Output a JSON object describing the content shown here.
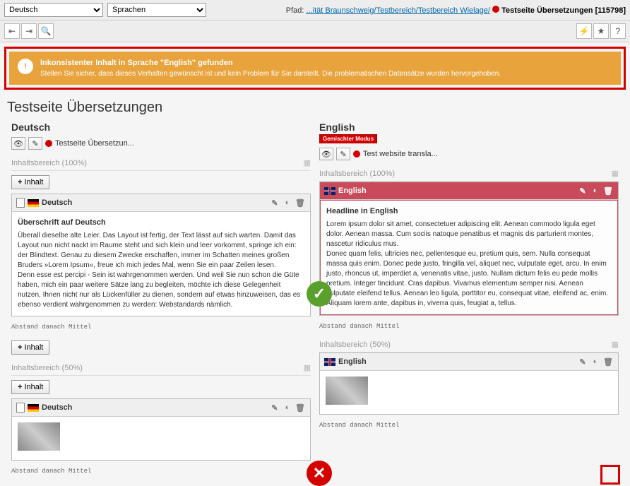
{
  "topbar": {
    "lang_select": "Deutsch",
    "col_select": "Sprachen",
    "path_label": "Pfad:",
    "path_trunc": "...ität Braunschweig/",
    "path_seg1": "Testbereich/",
    "path_seg2": "Testbereich Wielage/",
    "path_current": "Testseite Übersetzungen [115798]"
  },
  "alert": {
    "title": "Inkonsistenter Inhalt in Sprache \"English\" gefunden",
    "text": "Stellen Sie sicher, dass dieses Verhalten gewünscht ist und kein Problem für Sie darstellt. Die problematischen Datensätze wurden hervorgehoben."
  },
  "page_title": "Testseite Übersetzungen",
  "btn_inhalt": "Inhalt",
  "de": {
    "heading": "Deutsch",
    "page_name": "Testseite Übersetzun...",
    "section1": "Inhaltsbereich (100%)",
    "section2": "Inhaltsbereich (50%)",
    "card_title": "Deutsch",
    "headline": "Überschrift auf Deutsch",
    "para1": "Überall dieselbe alte Leier. Das Layout ist fertig, der Text lässt auf sich warten. Damit das Layout nun nicht nackt im Raume steht und sich klein und leer vorkommt, springe ich ein: der Blindtext. Genau zu diesem Zwecke erschaffen, immer im Schatten meines großen Bruders »Lorem Ipsum«, freue ich mich jedes Mal, wenn Sie ein paar Zeilen lesen.",
    "para2": "Denn esse est percipi - Sein ist wahrgenommen werden. Und weil Sie nun schon die Güte haben, mich ein paar weitere Sätze lang zu begleiten, möchte ich diese Gelegenheit nutzen, Ihnen nicht nur als Lückenfüller zu dienen, sondern auf etwas hinzuweisen, das es ebenso verdient wahrgenommen zu werden: Webstandards nämlich.",
    "meta": "Abstand danach Mittel"
  },
  "en": {
    "heading": "English",
    "mode_badge": "Gemischter Modus",
    "page_name": "Test website transla...",
    "section1": "Inhaltsbereich (100%)",
    "section2": "Inhaltsbereich (50%)",
    "card_title": "English",
    "headline": "Headline in English",
    "para1": "Lorem ipsum dolor sit amet, consectetuer adipiscing elit. Aenean commodo ligula eget dolor. Aenean massa. Cum sociis natoque penatibus et magnis dis parturient montes, nascetur ridiculus mus.",
    "para2": "Donec quam felis, ultricies nec, pellentesque eu, pretium quis, sem. Nulla consequat massa quis enim. Donec pede justo, fringilla vel, aliquet nec, vulputate eget, arcu. In enim justo, rhoncus ut, imperdiet a, venenatis vitae, justo. Nullam dictum felis eu pede mollis pretium. Integer tincidunt. Cras dapibus. Vivamus elementum semper nisi. Aenean vulputate eleifend tellus. Aenean leo ligula, porttitor eu, consequat vitae, eleifend ac, enim. Aliquam lorem ante, dapibus in, viverra quis, feugiat a, tellus.",
    "meta": "Abstand danach Mittel"
  }
}
